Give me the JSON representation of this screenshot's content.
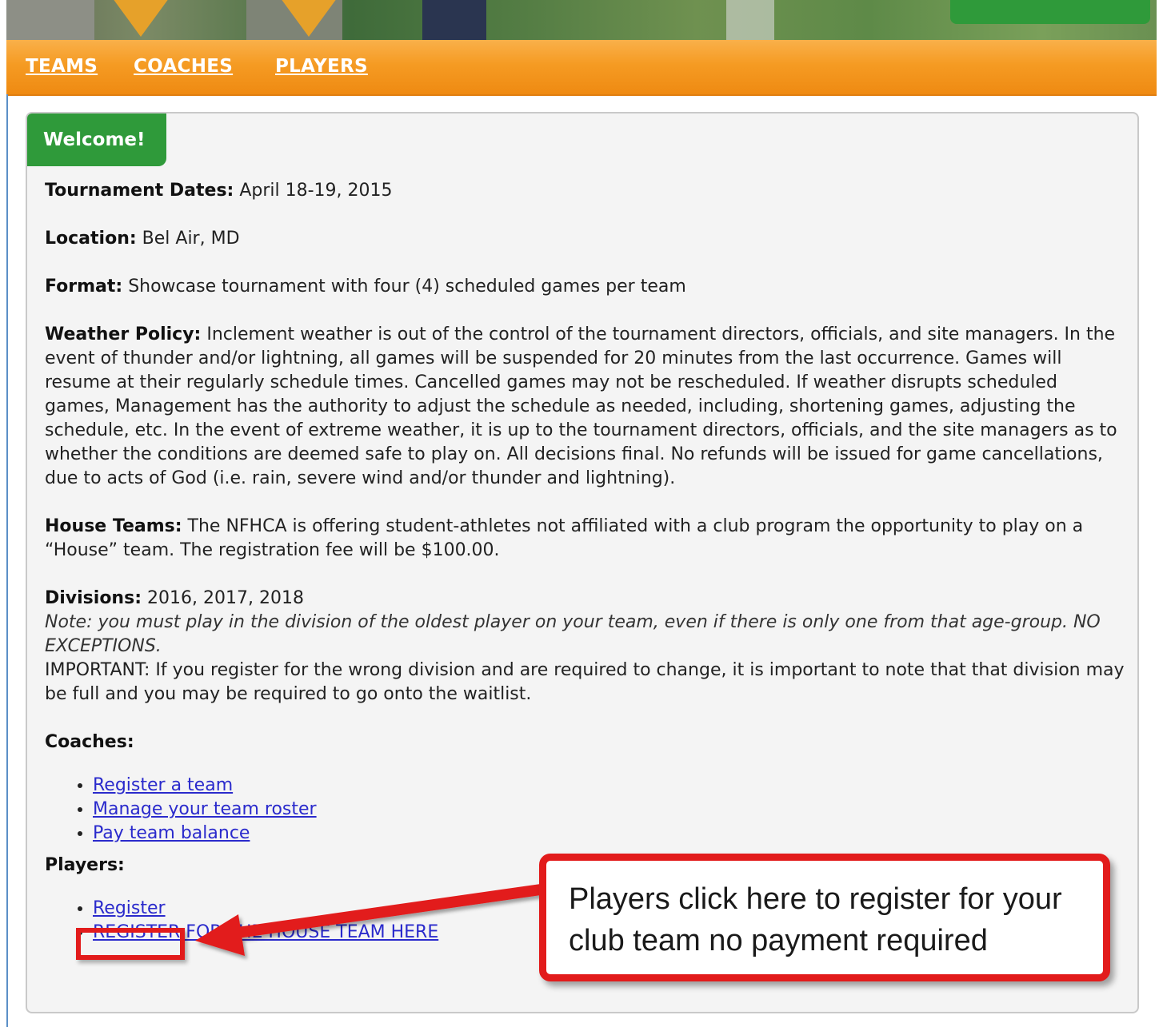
{
  "nav": {
    "items": [
      "TEAMS",
      "COACHES",
      "PLAYERS"
    ]
  },
  "panel": {
    "heading": "Welcome!",
    "dates_label": "Tournament Dates:",
    "dates_value": "April 18-19, 2015",
    "location_label": "Location:",
    "location_value": "Bel Air, MD",
    "format_label": "Format:",
    "format_value": "Showcase tournament with four (4) scheduled games per team",
    "weather_label": "Weather Policy:",
    "weather_value": "Inclement weather is out of the control of the tournament directors, officials, and site managers. In the event of thunder and/or lightning, all games will be suspended for 20 minutes from the last occurrence. Games will resume at their regularly schedule times. Cancelled games may not be rescheduled. If weather disrupts scheduled games, Management has the authority to adjust the schedule as needed, including, shortening games, adjusting the schedule, etc. In the event of extreme weather, it is up to the tournament directors, officials, and the site managers as to whether the conditions are deemed safe to play on. All decisions final. No refunds will be issued for game cancellations, due to acts of God (i.e. rain, severe wind and/or thunder and lightning).",
    "house_label": "House Teams:",
    "house_value": "The NFHCA is offering student-athletes not affiliated with a club program the opportunity to play on a “House” team. The registration fee will be $100.00.",
    "divisions_label": "Divisions:",
    "divisions_value": "2016, 2017, 2018",
    "divisions_note": "Note: you must play in the division of the oldest player on your team, even if there is only one from that age-group. NO EXCEPTIONS.",
    "divisions_important": "IMPORTANT: If you register for the wrong division and are required to change, it is important to note that that division may be full and you may be required to go onto the waitlist.",
    "coaches_label": "Coaches:",
    "coaches_links": [
      "Register a team",
      "Manage your team roster",
      "Pay team balance"
    ],
    "players_label": "Players:",
    "players_links": [
      "Register",
      "REGISTER FOR THE HOUSE TEAM HERE"
    ]
  },
  "annotation": {
    "callout_text": "Players click here to register for your club team no payment required",
    "color": "#e21b1b"
  },
  "colors": {
    "nav_orange": "#f59b23",
    "welcome_green": "#2f9a3a",
    "link_blue": "#2a2acc"
  }
}
